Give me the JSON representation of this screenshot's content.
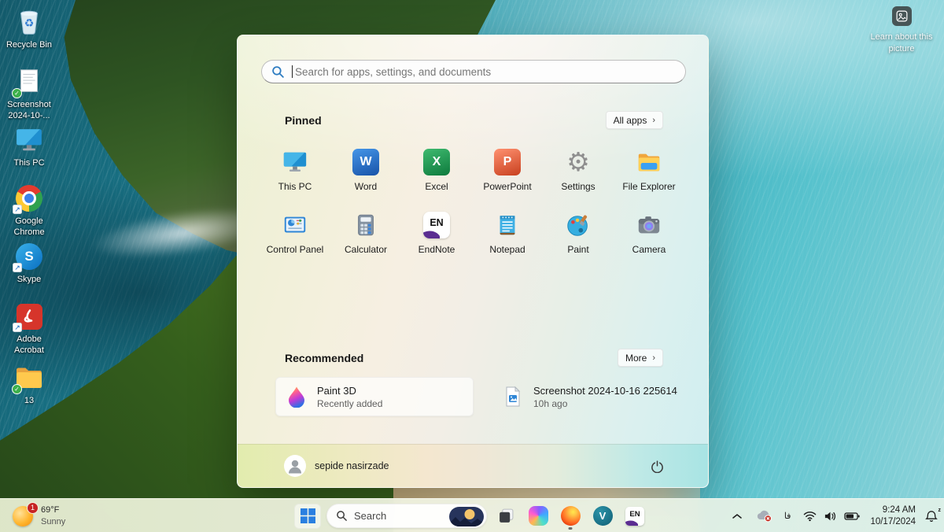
{
  "desktop": {
    "learn_about_label": "Learn about this picture",
    "icons": [
      {
        "label": "Recycle Bin"
      },
      {
        "label": "Screenshot 2024-10-..."
      },
      {
        "label": "This PC"
      },
      {
        "label": "Google Chrome"
      },
      {
        "label": "Skype"
      },
      {
        "label": "Adobe Acrobat"
      },
      {
        "label": "13"
      }
    ]
  },
  "start_menu": {
    "search_placeholder": "Search for apps, settings, and documents",
    "pinned_title": "Pinned",
    "all_apps_label": "All apps",
    "chevron": "›",
    "apps": [
      {
        "label": "This PC"
      },
      {
        "label": "Word",
        "glyph": "W"
      },
      {
        "label": "Excel",
        "glyph": "X"
      },
      {
        "label": "PowerPoint",
        "glyph": "P"
      },
      {
        "label": "Settings",
        "glyph": "⚙"
      },
      {
        "label": "File Explorer"
      },
      {
        "label": "Control Panel"
      },
      {
        "label": "Calculator"
      },
      {
        "label": "EndNote",
        "glyph": "EN"
      },
      {
        "label": "Notepad"
      },
      {
        "label": "Paint"
      },
      {
        "label": "Camera"
      }
    ],
    "recommended_title": "Recommended",
    "more_label": "More",
    "recommended": [
      {
        "title": "Paint 3D",
        "subtitle": "Recently added"
      },
      {
        "title": "Screenshot 2024-10-16 225614",
        "subtitle": "10h ago"
      }
    ],
    "user_name": "sepide nasirzade"
  },
  "taskbar": {
    "weather": {
      "badge": "1",
      "temperature": "69°F",
      "condition": "Sunny"
    },
    "search_label": "Search",
    "v_glyph": "V",
    "endnote_glyph": "EN",
    "tray": {
      "language": "فا",
      "time": "9:24 AM",
      "date": "10/17/2024"
    }
  },
  "glyphs": {
    "skype": "S",
    "recycle": "♻",
    "shortcut_arrow": "↗",
    "check": "✓"
  },
  "colors": {
    "accent_blue": "#2a7fe0",
    "taskbar_tint": "#eef3dd",
    "badge_red": "#c62324",
    "endnote_purple": "#5b2d91"
  }
}
